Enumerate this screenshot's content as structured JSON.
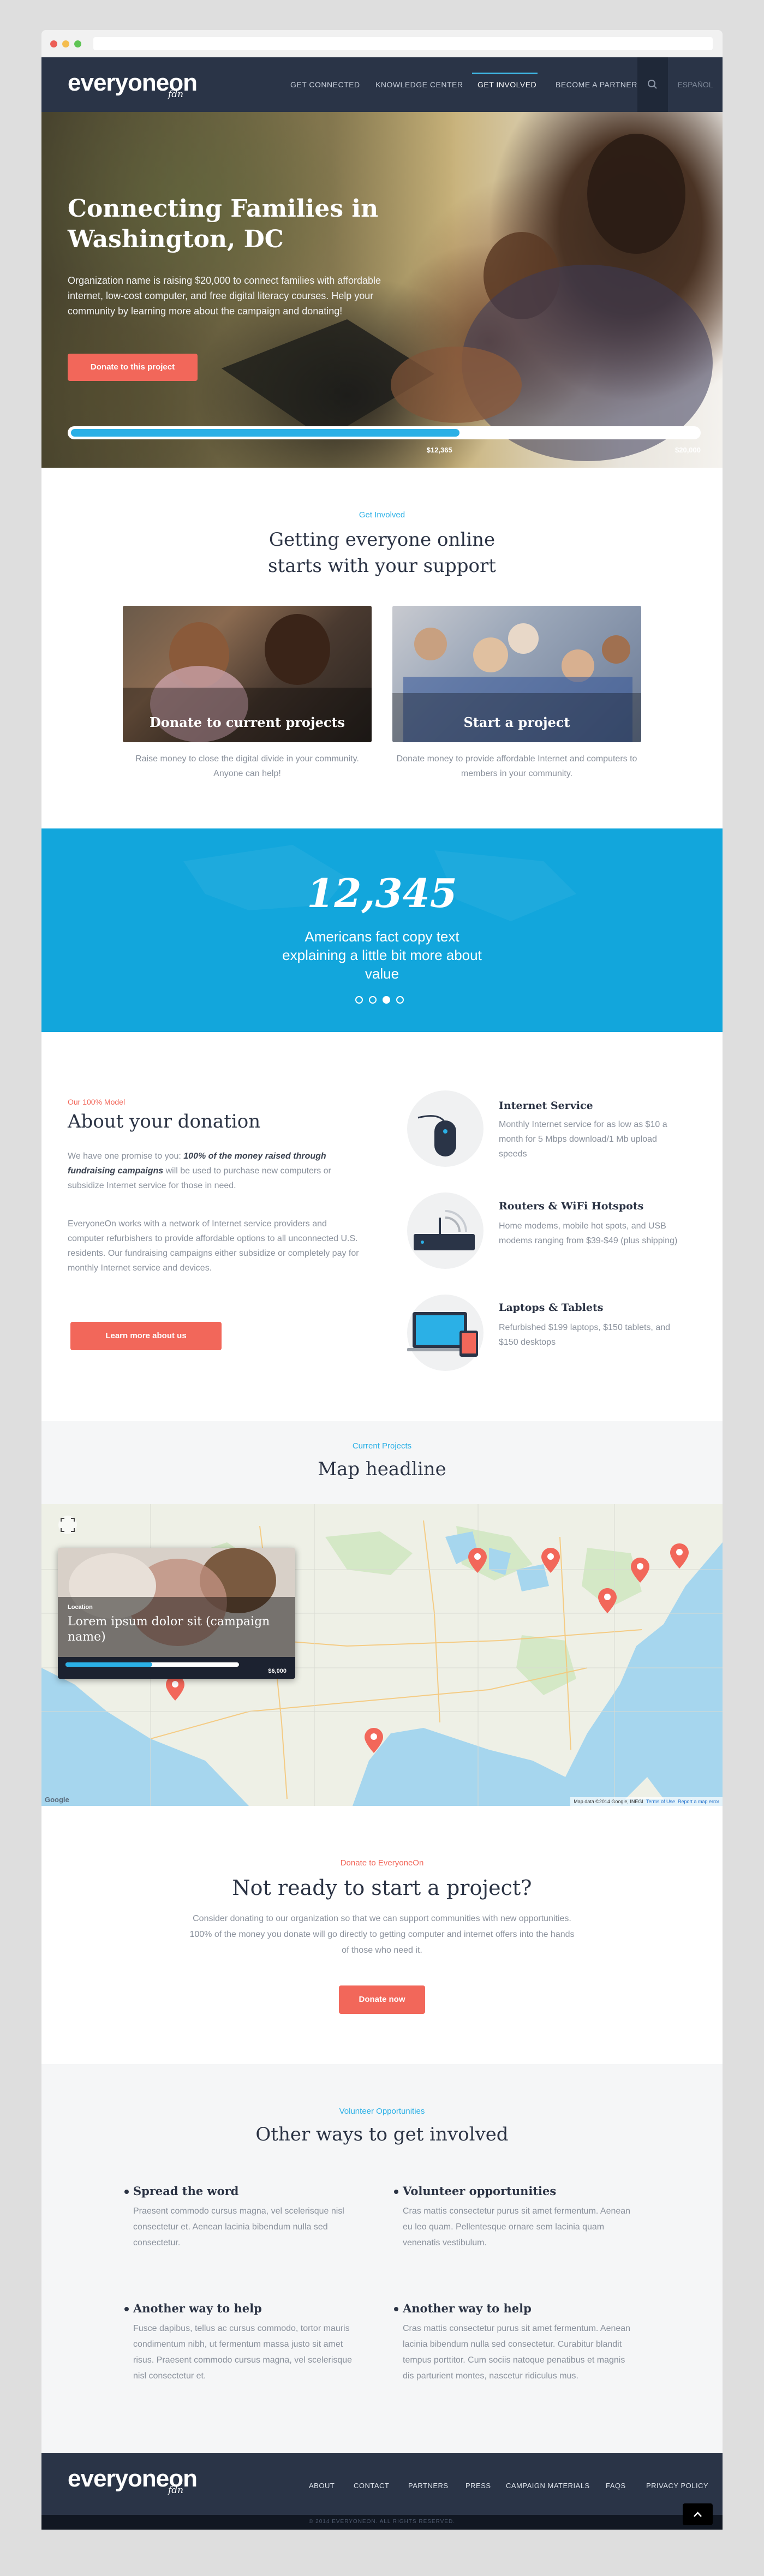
{
  "nav": {
    "logo": "everyoneon",
    "logo_tagline": "fdn",
    "items": [
      "GET CONNECTED",
      "KNOWLEDGE CENTER",
      "GET INVOLVED",
      "BECOME A PARTNER"
    ],
    "active_item": "GET INVOLVED",
    "search_icon": "search-icon",
    "language": "ESPAÑOL"
  },
  "hero": {
    "title": "Connecting Families in Washington, DC",
    "description": "Organization name is raising $20,000 to connect families with affordable internet, low-cost computer, and free digital literacy courses. Help your community by learning more about the campaign and donating!",
    "button": "Donate to this project",
    "raised": "$12,365",
    "goal": "$20,000",
    "progress": 0.62
  },
  "involved": {
    "eyebrow": "Get Involved",
    "title": "Getting everyone online starts with your support",
    "cards": [
      {
        "title": "Donate to current projects",
        "desc": "Raise money to close the digital divide in your community. Anyone can help!"
      },
      {
        "title": "Start a project",
        "desc": "Donate money to provide affordable Internet and computers to members in your community."
      }
    ]
  },
  "stats": {
    "number": "12,345",
    "text": "Americans fact copy text explaining a little bit more about value",
    "active_dot": 3,
    "dot_count": 4
  },
  "about": {
    "eyebrow": "Our 100% Model",
    "title": "About your donation",
    "p1_start": "We have one promise to you:",
    "p1_emphasis": "100% of the money raised through fundraising campaigns",
    "p1_end": "will be used to purchase new computers or subsidize Internet service for those in need.",
    "p2": "EveryoneOn works with a network of Internet service providers and computer refurbishers to provide affordable options to all unconnected U.S. residents. Our fundraising campaigns either subsidize or completely pay for monthly Internet service and devices.",
    "button": "Learn more about us",
    "features": [
      {
        "icon": "mouse-icon",
        "title": "Internet Service",
        "desc": "Monthly Internet service for as low as $10 a month for 5 Mbps download/1 Mb upload speeds"
      },
      {
        "icon": "router-icon",
        "title": "Routers & WiFi Hotspots",
        "desc": "Home modems, mobile hot spots, and USB modems ranging from $39-$49 (plus shipping)"
      },
      {
        "icon": "devices-icon",
        "title": "Laptops & Tablets",
        "desc": "Refurbished $199 laptops, $150 tablets, and $150 desktops"
      }
    ]
  },
  "map": {
    "eyebrow": "Current Projects",
    "title": "Map headline",
    "popup": {
      "location": "Location",
      "title": "Lorem ipsum dolor sit (campaign name)",
      "goal": "$6,000",
      "progress": 0.5
    },
    "attribution_left": "Google",
    "attribution_right": "Map data ©2014 Google, INEGI",
    "terms": "Terms of Use",
    "report": "Report a map error"
  },
  "cta": {
    "eyebrow": "Donate to EveryoneOn",
    "title": "Not ready to start a project?",
    "desc": "Consider donating to our organization so that we can support communities with new opportunities. 100% of the money you donate will go directly to getting computer and internet offers into the hands of those who need it.",
    "button": "Donate now"
  },
  "volunteer": {
    "eyebrow": "Volunteer Opportunities",
    "title": "Other ways to get involved",
    "items": [
      {
        "title": "Spread the word",
        "text": "Praesent commodo cursus magna, vel scelerisque nisl consectetur et. Aenean lacinia bibendum nulla sed consectetur."
      },
      {
        "title": "Volunteer opportunities",
        "text": "Cras mattis consectetur purus sit amet fermentum. Aenean eu leo quam. Pellentesque ornare sem lacinia quam venenatis vestibulum."
      },
      {
        "title": "Another way to help",
        "text": "Fusce dapibus, tellus ac cursus commodo, tortor mauris condimentum nibh, ut fermentum massa justo sit amet risus. Praesent commodo cursus magna, vel scelerisque nisl consectetur et."
      },
      {
        "title": "Another way to help",
        "text": "Cras mattis consectetur purus sit amet fermentum. Aenean lacinia bibendum nulla sed consectetur. Curabitur blandit tempus porttitor. Cum sociis natoque penatibus et magnis dis parturient montes, nascetur ridiculus mus."
      }
    ]
  },
  "footer": {
    "logo": "everyoneon",
    "items": [
      "ABOUT",
      "CONTACT",
      "PARTNERS",
      "PRESS",
      "CAMPAIGN MATERIALS",
      "FAQS",
      "PRIVACY POLICY"
    ],
    "copyright": "© 2014 EVERYONEON. ALL RIGHTS RESERVED."
  },
  "colors": {
    "navy": "#2a3447",
    "accent_blue": "#12a6dc",
    "coral": "#f2675a"
  }
}
